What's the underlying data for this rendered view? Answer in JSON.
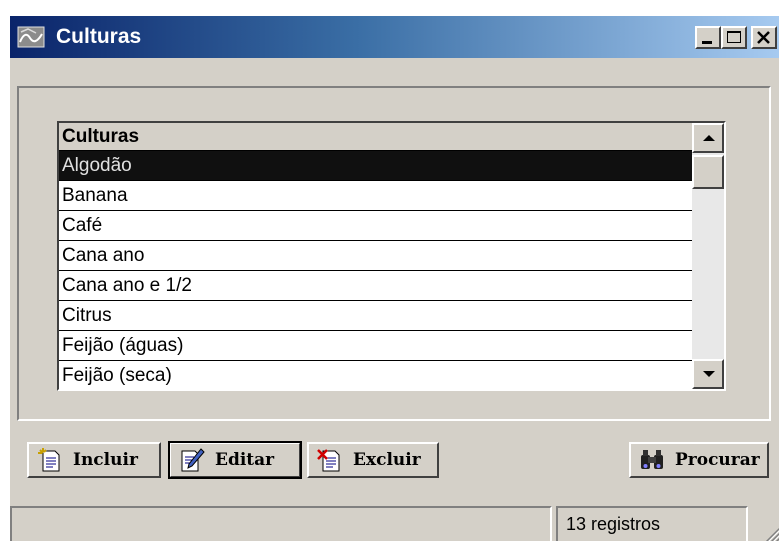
{
  "window": {
    "title": "Culturas"
  },
  "grid": {
    "header": "Culturas",
    "rows": [
      {
        "name": "Algodão",
        "selected": true
      },
      {
        "name": "Banana"
      },
      {
        "name": "Café"
      },
      {
        "name": "Cana ano"
      },
      {
        "name": "Cana ano e 1/2"
      },
      {
        "name": "Citrus"
      },
      {
        "name": "Feijão (águas)"
      },
      {
        "name": "Feijão (seca)"
      }
    ]
  },
  "toolbar": {
    "incluir_label": "Incluir",
    "editar_label": "Editar",
    "excluir_label": "Excluir",
    "procurar_label": "Procurar"
  },
  "status": {
    "record_count": "13 registros"
  },
  "colors": {
    "titlebar_start": "#0a246a",
    "titlebar_end": "#a6caf0",
    "face": "#d4d0c8"
  }
}
